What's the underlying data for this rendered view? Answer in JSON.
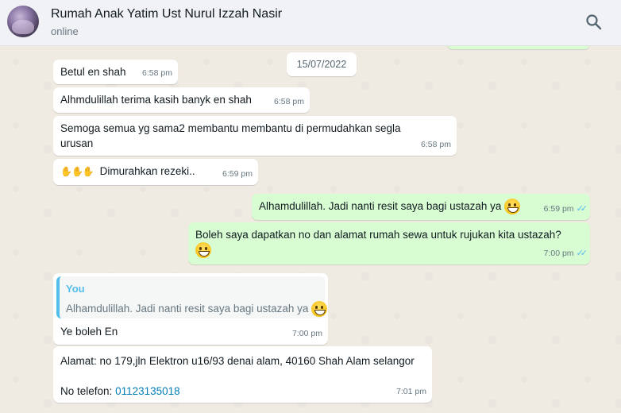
{
  "header": {
    "contact_name": "Rumah Anak Yatim Ust Nurul Izzah Nasir",
    "status": "online"
  },
  "date_separator": "15/07/2022",
  "messages": [
    {
      "text": "Betul en shah",
      "time": "6:58 pm"
    },
    {
      "text": "Alhmdulillah terima kasih banyk en shah",
      "time": "6:58 pm"
    },
    {
      "text_line1": "Semoga semua yg sama2 membantu membantu di permudahkan segla",
      "text_line2": "urusan",
      "time": "6:58 pm"
    },
    {
      "text": "Dimurahkan rezeki..",
      "time": "6:59 pm"
    },
    {
      "text": "Alhamdulillah. Jadi nanti resit saya bagi ustazah ya",
      "time": "6:59 pm"
    },
    {
      "text": "Boleh saya dapatkan no dan alamat rumah sewa untuk rujukan kita ustazah?",
      "time": "7:00 pm"
    },
    {
      "quote_author": "You",
      "quote_text": "Alhamdulillah. Jadi nanti resit saya bagi ustazah ya",
      "text": "Ye boleh En",
      "time": "7:00 pm"
    },
    {
      "address": "Alamat: no 179,jln Elektron u16/93 denai alam, 40160 Shah Alam selangor",
      "phone_label": "No telefon:",
      "phone": "01123135018",
      "time": "7:01 pm"
    }
  ],
  "colors": {
    "incoming": "#ffffff",
    "outgoing": "#d9fdd3",
    "tick": "#53bdeb",
    "link": "#027eb5"
  },
  "icons": {
    "search": "search-icon",
    "read_ticks": "double-check-icon",
    "emoji": "grinning-face-icon",
    "hands": "clapping-hands-icon"
  }
}
